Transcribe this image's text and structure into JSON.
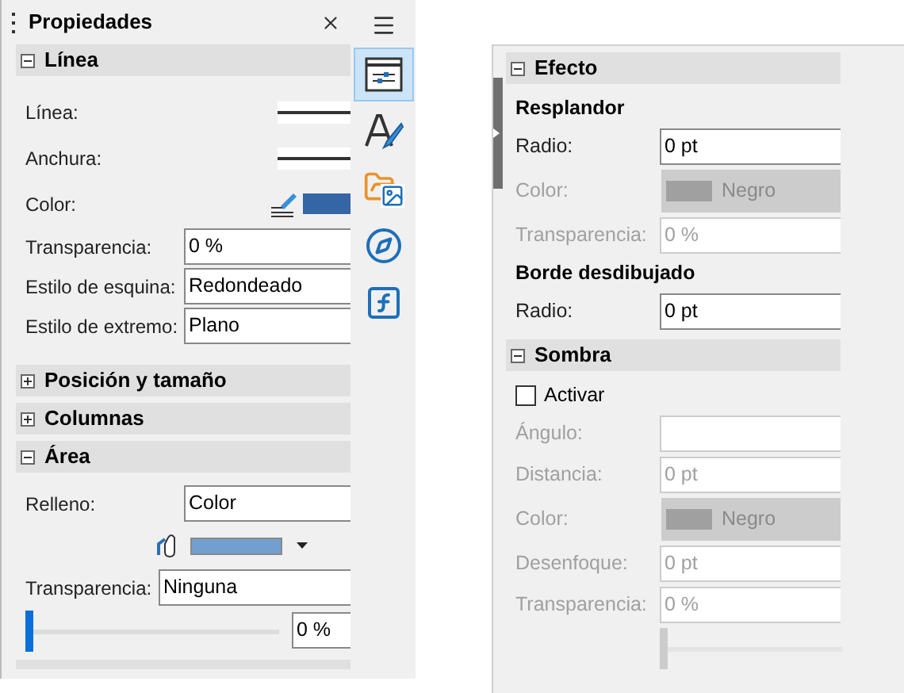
{
  "left_panel": {
    "title": "Propiedades",
    "tabs": [
      {
        "kind": "properties",
        "selected": true
      },
      {
        "kind": "styles",
        "selected": false
      },
      {
        "kind": "gallery",
        "selected": false
      },
      {
        "kind": "navigator",
        "selected": false
      },
      {
        "kind": "functions",
        "selected": false
      }
    ],
    "sections": [
      {
        "title": "Línea",
        "expanded": true,
        "rows": [
          {
            "kind": "line",
            "label": "Línea:"
          },
          {
            "kind": "line",
            "label": "Anchura:"
          },
          {
            "kind": "color",
            "label": "Color:",
            "color": "#3465a4"
          },
          {
            "kind": "field",
            "label": "Transparencia:",
            "value": "0 %"
          },
          {
            "kind": "field",
            "label": "Estilo de esquina:",
            "value": "Redondeado"
          },
          {
            "kind": "field",
            "label": "Estilo de extremo:",
            "value": "Plano"
          }
        ]
      },
      {
        "title": "Posición y tamaño",
        "expanded": false
      },
      {
        "title": "Columnas",
        "expanded": false
      },
      {
        "title": "Área",
        "expanded": true,
        "rows": [
          {
            "kind": "field",
            "label": "Relleno:",
            "value": "Color"
          },
          {
            "kind": "fill",
            "color": "#729fcf"
          },
          {
            "kind": "field",
            "label": "Transparencia:",
            "value": "Ninguna"
          },
          {
            "kind": "slider",
            "level": 0,
            "value": "0 %"
          }
        ]
      }
    ]
  },
  "right_panel": {
    "sections": [
      {
        "title": "Efecto",
        "expanded": true,
        "rows": [
          {
            "kind": "heading",
            "label": "Resplandor"
          },
          {
            "kind": "field",
            "label": "Radio:",
            "value": "0 pt",
            "disabled": false
          },
          {
            "kind": "color",
            "label": "Color:",
            "value": "Negro",
            "disabled": true
          },
          {
            "kind": "field",
            "label": "Transparencia:",
            "value": "0 %",
            "disabled": true
          },
          {
            "kind": "heading",
            "label": "Borde desdibujado"
          },
          {
            "kind": "field",
            "label": "Radio:",
            "value": "0 pt",
            "disabled": false
          }
        ]
      },
      {
        "title": "Sombra",
        "expanded": true,
        "rows": [
          {
            "kind": "checkbox",
            "label": "Activar",
            "checked": false
          },
          {
            "kind": "field",
            "label": "Ángulo:",
            "disabled": true
          },
          {
            "kind": "field",
            "label": "Distancia:",
            "value": "0 pt",
            "disabled": true
          },
          {
            "kind": "color",
            "label": "Color:",
            "value": "Negro",
            "disabled": true
          },
          {
            "kind": "field",
            "label": "Desenfoque:",
            "value": "0 pt",
            "disabled": true
          },
          {
            "kind": "field",
            "label": "Transparencia:",
            "value": "0 %",
            "disabled": true
          },
          {
            "kind": "slider",
            "level": 0,
            "disabled": true
          }
        ]
      }
    ]
  }
}
